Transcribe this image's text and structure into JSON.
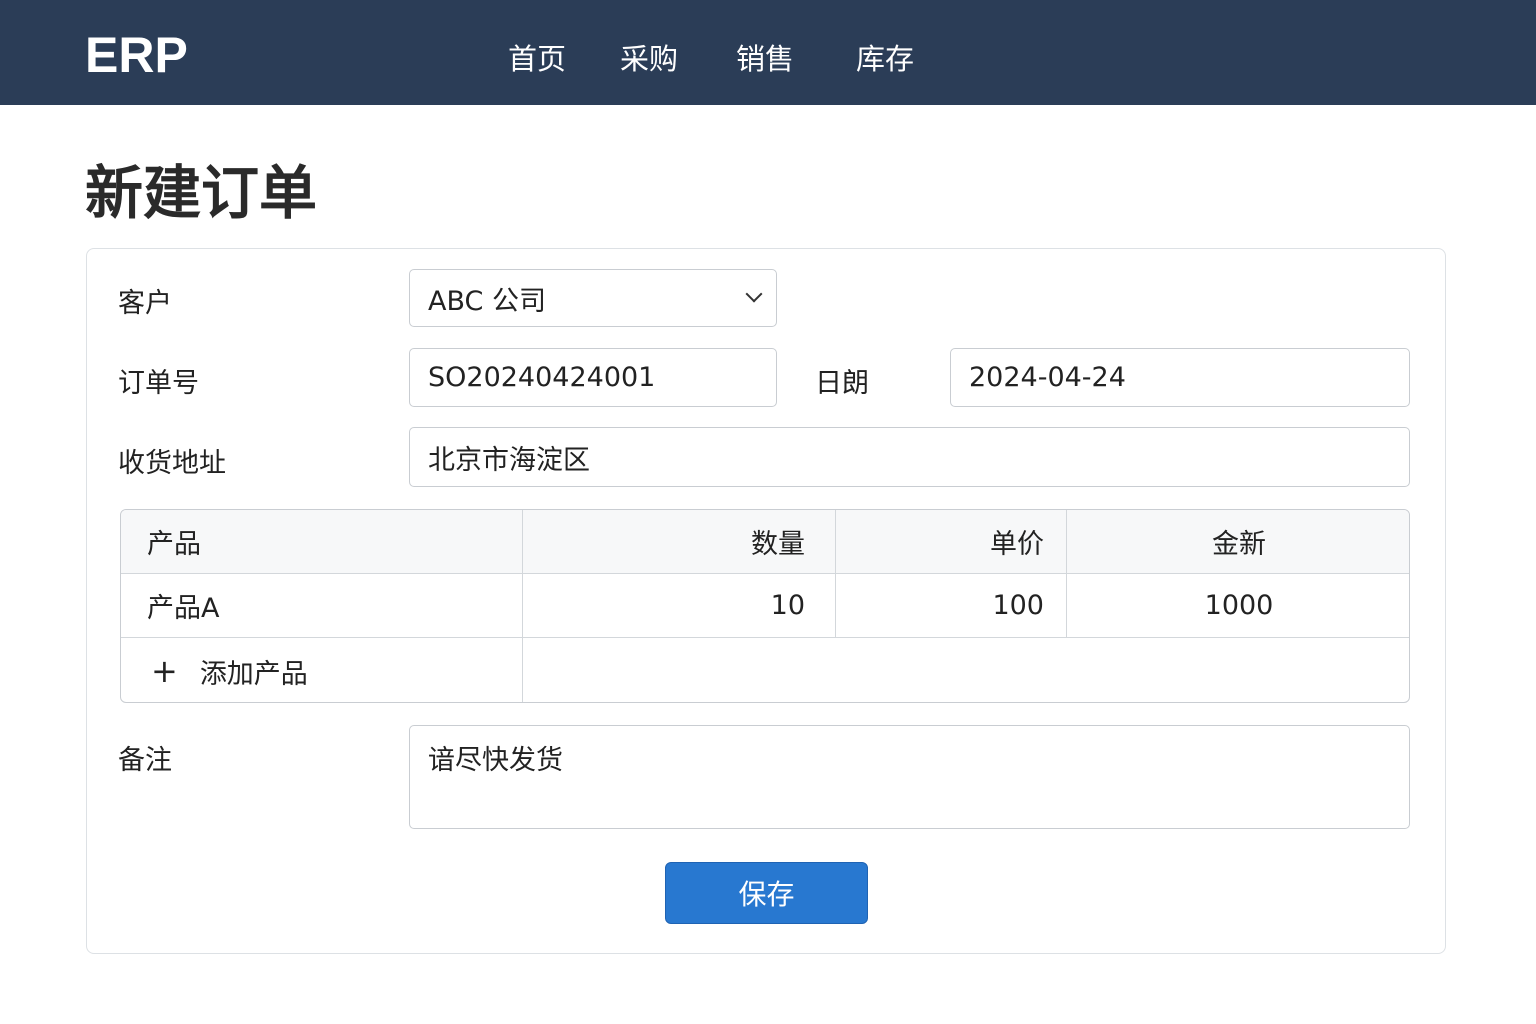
{
  "header": {
    "logo": "ERP",
    "nav": [
      "首页",
      "采购",
      "销售",
      "库存"
    ]
  },
  "page_title": "新建订单",
  "form": {
    "customer_label": "客户",
    "customer_value": "ABC 公司",
    "order_no_label": "订单号",
    "order_no_value": "SO20240424001",
    "date_label": "日朗",
    "date_value": "2024-04-24",
    "address_label": "收货地址",
    "address_value": "北京市海淀区",
    "remark_label": "备注",
    "remark_value": "谙尽快发货"
  },
  "table": {
    "headers": [
      "产品",
      "数量",
      "单价",
      "金新"
    ],
    "rows": [
      [
        "产品A",
        "10",
        "100",
        "1000"
      ]
    ],
    "add_label": "添加产品",
    "add_icon": "plus-icon"
  },
  "save_label": "保存"
}
